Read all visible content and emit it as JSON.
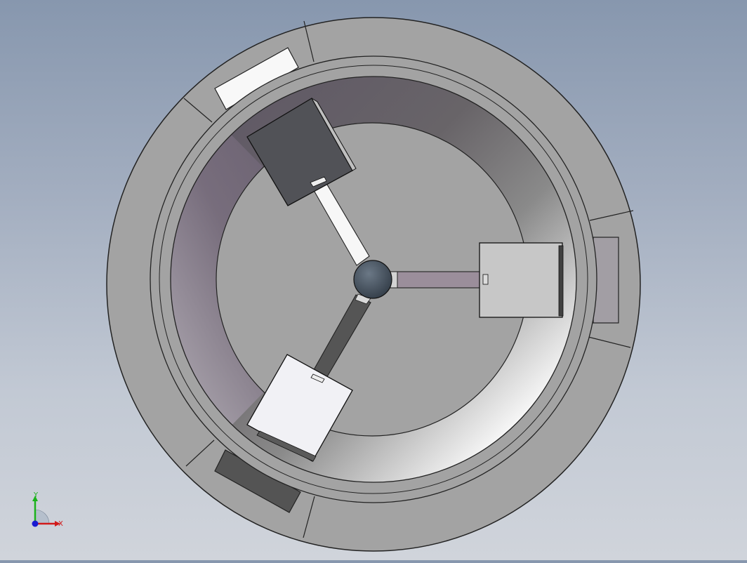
{
  "viewport": {
    "background_top": "#8797ae",
    "background_bottom": "#d0d4db"
  },
  "model": {
    "outer_ring_color": "#a3a3a3",
    "inner_floor_color": "#a3a3a3",
    "hub_color": "#4a5663",
    "arm_count": 3,
    "blade_colors": [
      "#515257",
      "#c7c7c7",
      "#f1f1f5"
    ],
    "arm_colors": [
      "#f7f7f7",
      "#9b8e9b",
      "#555555"
    ],
    "slot_colors": [
      "#f8f8f8",
      "#a29ea4",
      "#545454"
    ]
  },
  "triad": {
    "x_label": "X",
    "y_label": "Y",
    "x_color": "#d11a1a",
    "y_color": "#1bb21b",
    "z_color": "#1a1ad1",
    "x_icon": "x-axis-arrow-icon",
    "y_icon": "y-axis-arrow-icon",
    "z_icon": "z-axis-dot-icon"
  }
}
